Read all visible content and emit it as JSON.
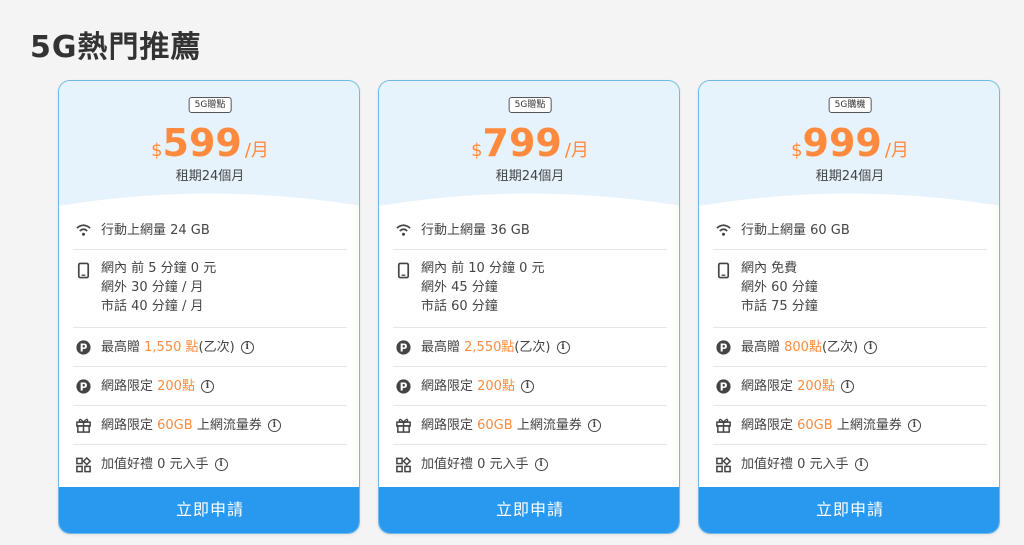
{
  "page_title": "5G熱門推薦",
  "plans": [
    {
      "badge": "5G贈點",
      "currency": "$",
      "price": "599",
      "unit": "/月",
      "term": "租期24個月",
      "data_label": "行動上網量 24 GB",
      "voice_lines": [
        "網內 前 5 分鐘 0 元",
        "網外 30 分鐘 / 月",
        "市話 40 分鐘 / 月"
      ],
      "points_prefix": "最高贈 ",
      "points_value": "1,550 點",
      "points_suffix": "(乙次)",
      "online_prefix": "網路限定 ",
      "online_value": "200點",
      "coupon_prefix": "網路限定 ",
      "coupon_value": "60GB",
      "coupon_suffix": " 上網流量券",
      "gift_label": "加值好禮 0 元入手",
      "button": "立即申請"
    },
    {
      "badge": "5G贈點",
      "currency": "$",
      "price": "799",
      "unit": "/月",
      "term": "租期24個月",
      "data_label": "行動上網量 36 GB",
      "voice_lines": [
        "網內 前 10 分鐘 0 元",
        "網外 45 分鐘",
        "市話 60 分鐘"
      ],
      "points_prefix": "最高贈 ",
      "points_value": "2,550點",
      "points_suffix": "(乙次)",
      "online_prefix": "網路限定 ",
      "online_value": "200點",
      "coupon_prefix": "網路限定 ",
      "coupon_value": "60GB",
      "coupon_suffix": " 上網流量券",
      "gift_label": "加值好禮 0 元入手",
      "button": "立即申請"
    },
    {
      "badge": "5G購機",
      "currency": "$",
      "price": "999",
      "unit": "/月",
      "term": "租期24個月",
      "data_label": "行動上網量 60 GB",
      "voice_lines": [
        "網內 免費",
        "網外 60 分鐘",
        "市話 75 分鐘"
      ],
      "points_prefix": "最高贈 ",
      "points_value": "800點",
      "points_suffix": "(乙次)",
      "online_prefix": "網路限定 ",
      "online_value": "200點",
      "coupon_prefix": "網路限定 ",
      "coupon_value": "60GB",
      "coupon_suffix": " 上網流量券",
      "gift_label": "加值好禮 0 元入手",
      "button": "立即申請"
    }
  ],
  "icons": {
    "data": "wifi-icon",
    "voice": "phone-icon",
    "points": "points-p-icon",
    "online": "points-p-icon",
    "coupon": "gift-icon",
    "gift": "apps-grid-icon",
    "info": "info-icon"
  },
  "colors": {
    "accent": "#ff8a3d",
    "button": "#2899ee",
    "card_border": "#6fb9ea",
    "header_bg": "#e6f3fd"
  }
}
